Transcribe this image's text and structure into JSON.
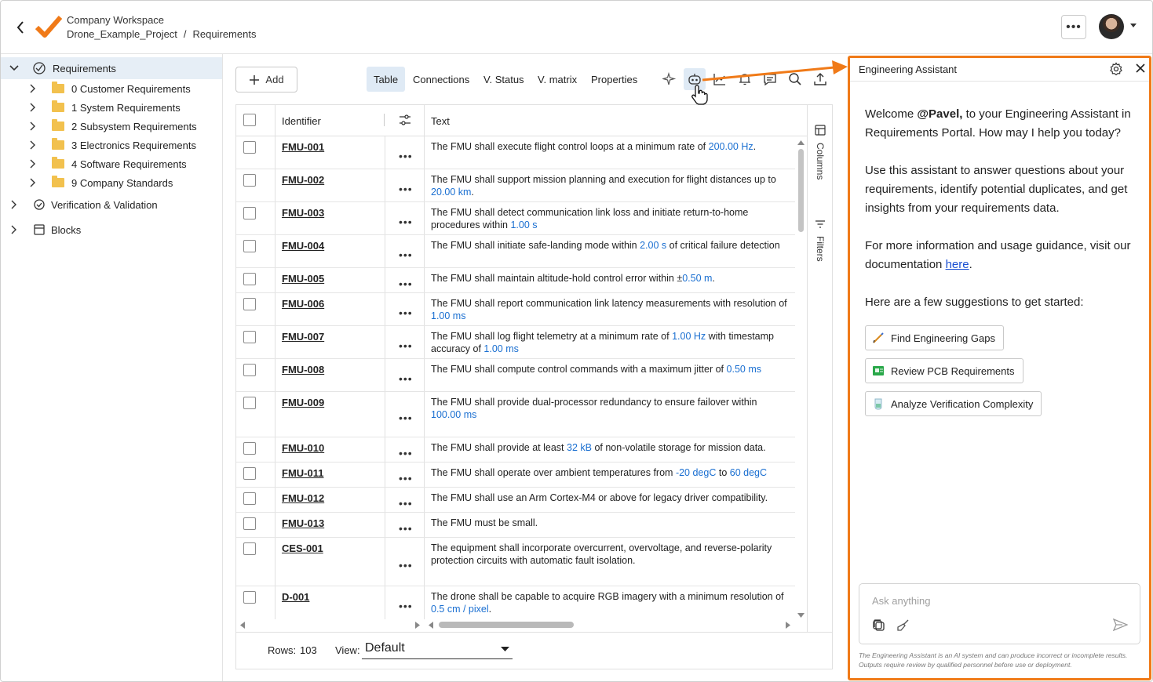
{
  "header": {
    "workspace": "Company Workspace",
    "project": "Drone_Example_Project",
    "separator": "/",
    "section": "Requirements",
    "more_label": "•••"
  },
  "sidebar": {
    "root": "Requirements",
    "folders": [
      "0 Customer Requirements",
      "1 System Requirements",
      "2 Subsystem Requirements",
      "3 Electronics Requirements",
      "4 Software Requirements",
      "9 Company Standards"
    ],
    "verification": "Verification & Validation",
    "blocks": "Blocks"
  },
  "toolbar": {
    "add_label": "Add",
    "tabs": [
      "Table",
      "Connections",
      "V. Status",
      "V. matrix",
      "Properties"
    ],
    "active_tab": "Table"
  },
  "grid": {
    "col_identifier": "Identifier",
    "col_text": "Text",
    "columns_label": "Columns",
    "filters_label": "Filters",
    "dots": "•••",
    "rows": [
      {
        "id": "FMU-001",
        "parts": [
          [
            "The FMU shall execute flight control loops at a minimum rate of ",
            0
          ],
          [
            "200.00  Hz",
            1
          ],
          [
            ".",
            0
          ]
        ]
      },
      {
        "id": "FMU-002",
        "parts": [
          [
            "The FMU shall support mission planning and execution for flight distances up to ",
            0
          ],
          [
            "\n",
            0
          ],
          [
            "20.00  km",
            1
          ],
          [
            ".",
            0
          ]
        ]
      },
      {
        "id": "FMU-003",
        "parts": [
          [
            "The FMU shall detect communication link loss and initiate return-to-home ",
            0
          ],
          [
            "\n",
            0
          ],
          [
            "procedures within ",
            0
          ],
          [
            "1.00  s",
            1
          ]
        ]
      },
      {
        "id": "FMU-004",
        "parts": [
          [
            "The FMU shall initiate safe-landing mode within ",
            0
          ],
          [
            "2.00  s",
            1
          ],
          [
            " of critical failure detection",
            0
          ]
        ]
      },
      {
        "id": "FMU-005",
        "parts": [
          [
            "The FMU shall maintain altitude-hold control error within ±",
            0
          ],
          [
            "0.50  m",
            1
          ],
          [
            ".",
            0
          ]
        ]
      },
      {
        "id": "FMU-006",
        "parts": [
          [
            "The FMU shall report communication link latency measurements with resolution of",
            0
          ],
          [
            "\n",
            0
          ],
          [
            "1.00  ms",
            1
          ]
        ]
      },
      {
        "id": "FMU-007",
        "parts": [
          [
            "The FMU shall log flight telemetry at a minimum rate of ",
            0
          ],
          [
            "1.00  Hz",
            1
          ],
          [
            " with timestamp",
            0
          ],
          [
            "\n",
            0
          ],
          [
            "accuracy of ",
            0
          ],
          [
            "1.00  ms",
            1
          ]
        ]
      },
      {
        "id": "FMU-008",
        "parts": [
          [
            "The FMU shall compute control commands with a maximum jitter of ",
            0
          ],
          [
            "0.50  ms",
            1
          ]
        ]
      },
      {
        "id": "FMU-009",
        "parts": [
          [
            "The FMU shall provide dual-processor redundancy to ensure failover within",
            0
          ],
          [
            "\n",
            0
          ],
          [
            "100.00  ms",
            1
          ]
        ]
      },
      {
        "id": "FMU-010",
        "parts": [
          [
            "The FMU shall provide at least ",
            0
          ],
          [
            "32  kB",
            1
          ],
          [
            " of non-volatile storage for mission data.",
            0
          ]
        ]
      },
      {
        "id": "FMU-011",
        "parts": [
          [
            "The FMU shall operate over ambient temperatures from ",
            0
          ],
          [
            "-20  degC",
            1
          ],
          [
            " to ",
            0
          ],
          [
            "60  degC",
            1
          ]
        ]
      },
      {
        "id": "FMU-012",
        "parts": [
          [
            "The FMU shall use an Arm Cortex-M4 or above for legacy driver compatibility.",
            0
          ]
        ]
      },
      {
        "id": "FMU-013",
        "parts": [
          [
            "The FMU must be small.",
            0
          ]
        ]
      },
      {
        "id": "CES-001",
        "parts": [
          [
            "The equipment shall incorporate overcurrent, overvoltage, and reverse-polarity",
            0
          ],
          [
            "\n",
            0
          ],
          [
            "protection circuits with automatic fault isolation.",
            0
          ]
        ]
      },
      {
        "id": "D-001",
        "parts": [
          [
            "The drone shall be capable to acquire RGB imagery with a minimum resolution of",
            0
          ],
          [
            "\n",
            0
          ],
          [
            "0.5  cm / pixel",
            1
          ],
          [
            ".",
            0
          ]
        ]
      }
    ]
  },
  "footer": {
    "rows_label": "Rows:",
    "rows_count": "103",
    "view_label": "View:",
    "view_value": "Default"
  },
  "assistant": {
    "title": "Engineering Assistant",
    "welcome_pre": "Welcome ",
    "user": "@Pavel,",
    "welcome_post": " to your Engineering Assistant in Requirements Portal. How may I help you today?",
    "intro": "Use this assistant to answer questions about your requirements, identify potential duplicates, and get insights from your requirements data.",
    "info_pre": "For more information and usage guidance, visit our documentation ",
    "info_link": "here",
    "info_post": ".",
    "suggest_heading": "Here are a few suggestions to get started:",
    "suggestions": [
      "Find Engineering Gaps",
      "Review PCB Requirements",
      "Analyze Verification Complexity"
    ],
    "input_placeholder": "Ask anything",
    "disclaimer": "The Engineering Assistant is an AI system and can produce incorrect or incomplete results. Outputs require review by qualified personnel before use or deployment."
  },
  "colors": {
    "accent_orange": "#f07a18",
    "quantity_blue": "#1a6fd1",
    "selected_bg": "#e6eef6",
    "folder_yellow": "#f2c14e"
  }
}
